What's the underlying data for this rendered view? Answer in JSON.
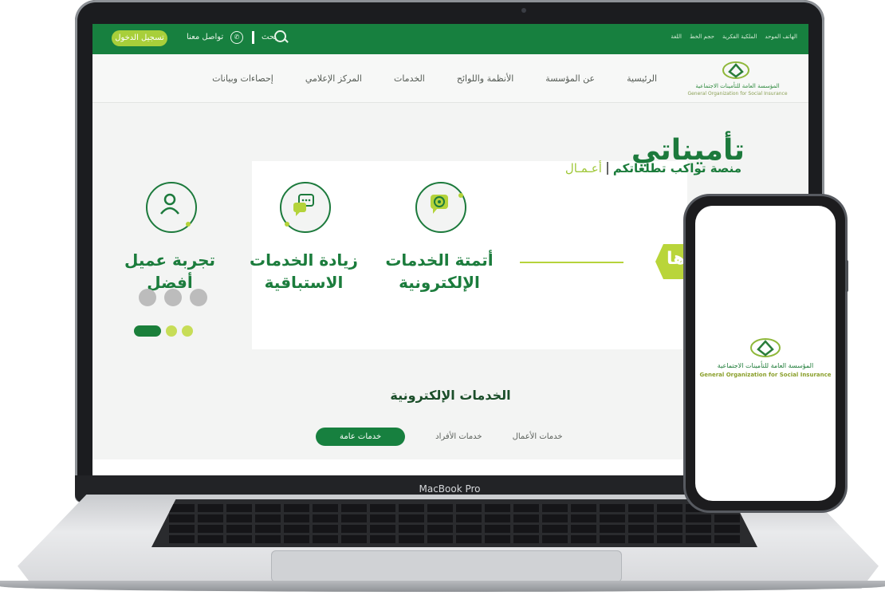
{
  "topbar": {
    "login": "تسجيل الدخول",
    "contact": "تواصل معنا",
    "search": "بحث",
    "right_items": [
      "اللغة",
      "حجم الخط",
      "الملكية الفكرية",
      "الهاتف الموحد"
    ]
  },
  "nav": {
    "items": [
      "الرئيسية",
      "عن المؤسسة",
      "الأنظمة واللوائح",
      "الخدمات",
      "المركز الإعلامي",
      "إحصاءات وبيانات"
    ]
  },
  "brand": {
    "arabic": "المؤسسة العامة للتأمينات الاجتماعية",
    "english": "General Organization for Social Insurance"
  },
  "hero": {
    "title": "تأميناتي",
    "subtitle_highlight": "أعـمـال",
    "subtitle": "منصة تواكب تطلعاتكم",
    "arrow_text": "ها"
  },
  "cards": [
    {
      "label": "أتمتة الخدمات الإلكترونية",
      "icon": "gear-chat-icon"
    },
    {
      "label": "زيادة الخدمات الاستباقية",
      "icon": "chat-bubbles-icon"
    },
    {
      "label": "تجربة عميل أفضل",
      "icon": "user-icon"
    }
  ],
  "section": {
    "title": "الخدمات الإلكترونية",
    "tabs": [
      "خدمات عامة",
      "خدمات الأفراد",
      "خدمات الأعمال"
    ]
  },
  "device": {
    "chin_label": "MacBook Pro"
  },
  "phone": {
    "arabic": "المؤسسة العامة للتأمينات الاجتماعية",
    "english": "General Organization for Social Insurance"
  },
  "colors": {
    "primary_green": "#17803f",
    "accent_lime": "#a8cf3a"
  }
}
